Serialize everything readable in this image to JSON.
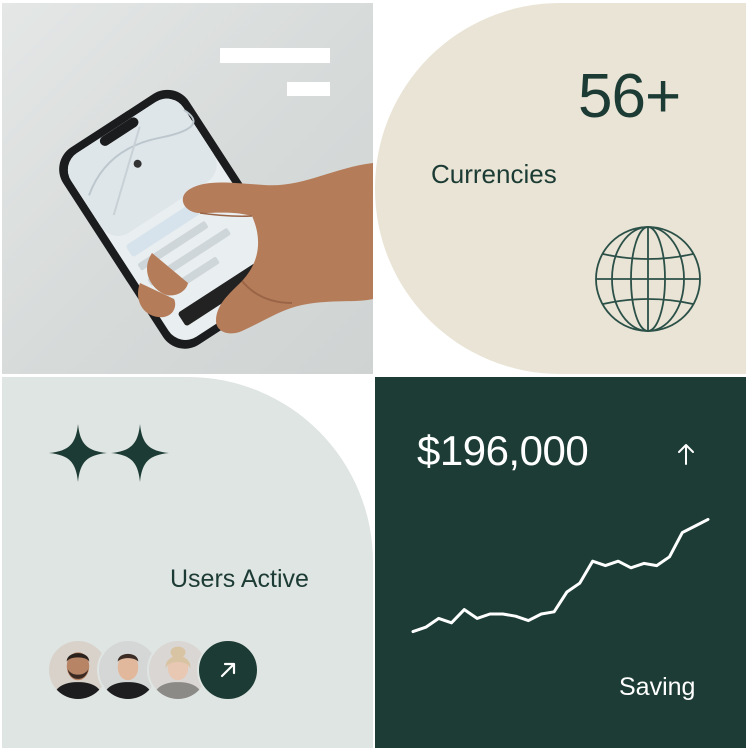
{
  "currencies": {
    "count": "56+",
    "label": "Currencies"
  },
  "users": {
    "label": "Users Active",
    "avatars": [
      {
        "name": "avatar-bearded-man"
      },
      {
        "name": "avatar-young-man"
      },
      {
        "name": "avatar-blonde-woman"
      }
    ]
  },
  "savings": {
    "amount": "$196,000",
    "label": "Saving",
    "trend": "up"
  },
  "colors": {
    "accent_dark_green": "#1c3c35",
    "cream": "#e9e4d5",
    "mint": "#dfe5e2",
    "white": "#ffffff"
  },
  "icons": [
    "globe-icon",
    "sparkle-icon",
    "arrow-up-right-icon",
    "up-arrow-icon"
  ],
  "chart_data": {
    "type": "line",
    "x": [
      1,
      2,
      3,
      4,
      5,
      6,
      7,
      8,
      9,
      10,
      11,
      12,
      13,
      14,
      15,
      16,
      17,
      18,
      19,
      20,
      21,
      22,
      23,
      24
    ],
    "values": [
      12,
      14,
      18,
      16,
      22,
      18,
      20,
      20,
      19,
      17,
      20,
      21,
      30,
      34,
      44,
      42,
      44,
      41,
      43,
      42,
      46,
      57,
      60,
      63
    ],
    "title": "",
    "xlabel": "",
    "ylabel": "",
    "ylim": [
      0,
      70
    ],
    "grid": false,
    "legend": "none"
  }
}
